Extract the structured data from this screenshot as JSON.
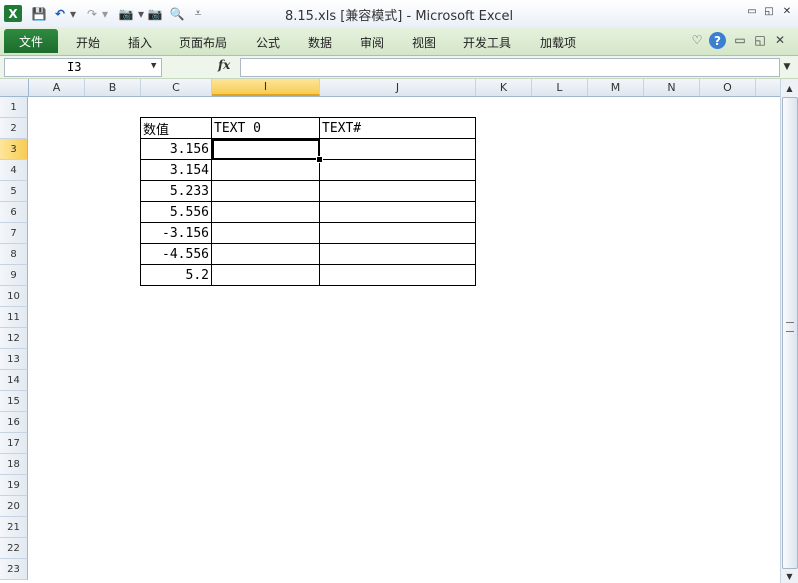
{
  "window": {
    "title": "8.15.xls  [兼容模式] - Microsoft Excel",
    "controls": {
      "minimize": "▭",
      "restore": "◱",
      "close": "✕"
    }
  },
  "quick_access": {
    "app_icon": "X",
    "save": "💾",
    "undo": "↶",
    "redo": "↷",
    "dropdown": "▾",
    "camera": "📷",
    "preview": "🔍",
    "customize": "⩡"
  },
  "ribbon": {
    "tabs": [
      "文件",
      "开始",
      "插入",
      "页面布局",
      "公式",
      "数据",
      "审阅",
      "视图",
      "开发工具",
      "加载项"
    ],
    "right_icons": {
      "collapse": "♡",
      "help": "?",
      "min": "▭",
      "restore": "◱",
      "close": "✕"
    }
  },
  "formula_bar": {
    "name_box": "I3",
    "fx": "fx",
    "value": ""
  },
  "columns": [
    "A",
    "B",
    "C",
    "I",
    "J",
    "K",
    "L",
    "M",
    "N",
    "O"
  ],
  "rows": [
    "1",
    "2",
    "3",
    "4",
    "5",
    "6",
    "7",
    "8",
    "9",
    "10",
    "11",
    "12",
    "13",
    "14",
    "15",
    "16",
    "17",
    "18",
    "19",
    "20",
    "21",
    "22",
    "23"
  ],
  "selected_cell": "I3",
  "table": {
    "headers": [
      "数值",
      "TEXT 0",
      "TEXT#"
    ],
    "values": [
      "3.156",
      "3.154",
      "5.233",
      "5.556",
      "-3.156",
      "-4.556",
      "5.2"
    ]
  },
  "colors": {
    "ribbon_green": "#2e8b3f",
    "selection": "#f8cc54"
  }
}
